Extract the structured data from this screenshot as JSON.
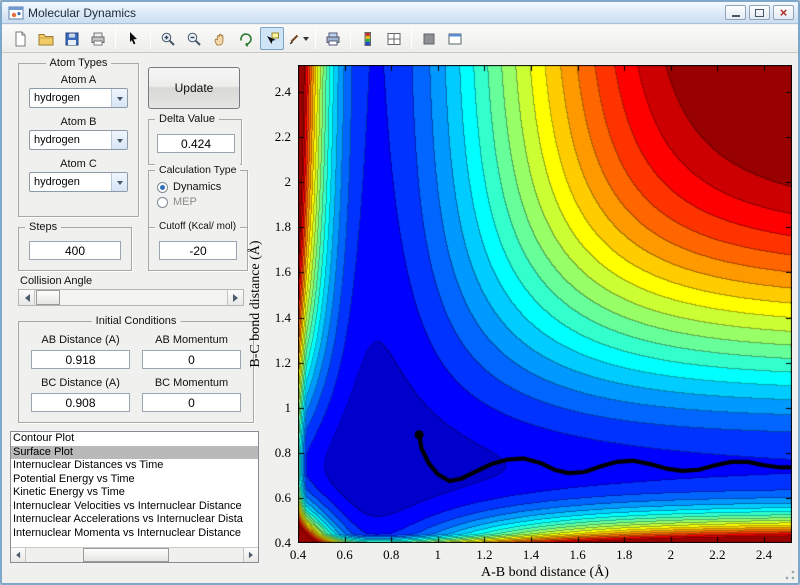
{
  "window": {
    "title": "Molecular Dynamics"
  },
  "titlebar": {
    "buttons": [
      "minimize",
      "maximize",
      "close"
    ]
  },
  "toolbar": {
    "buttons": [
      {
        "name": "new-file"
      },
      {
        "name": "open-file"
      },
      {
        "name": "save"
      },
      {
        "name": "print"
      },
      {
        "separator": true
      },
      {
        "name": "cursor"
      },
      {
        "separator": true
      },
      {
        "name": "zoom-in"
      },
      {
        "name": "zoom-out"
      },
      {
        "name": "pan"
      },
      {
        "name": "rotate-3d"
      },
      {
        "name": "data-cursor",
        "pressed": true
      },
      {
        "name": "brush",
        "dropdown": true
      },
      {
        "separator": true
      },
      {
        "name": "print-figure"
      },
      {
        "separator": true
      },
      {
        "name": "colorbar"
      },
      {
        "name": "subplot"
      },
      {
        "separator": true
      },
      {
        "name": "stop"
      },
      {
        "name": "figure-window"
      }
    ]
  },
  "panels": {
    "atom_types": {
      "title": "Atom Types",
      "fields": [
        {
          "label": "Atom A",
          "value": "hydrogen"
        },
        {
          "label": "Atom B",
          "value": "hydrogen"
        },
        {
          "label": "Atom C",
          "value": "hydrogen"
        }
      ]
    },
    "update_button_label": "Update",
    "delta": {
      "title": "Delta Value",
      "value": "0.424"
    },
    "calculation_type": {
      "title": "Calculation Type",
      "options": [
        {
          "label": "Dynamics",
          "selected": true
        },
        {
          "label": "MEP",
          "selected": false
        }
      ]
    },
    "steps": {
      "title": "Steps",
      "value": "400"
    },
    "cutoff": {
      "title": "Cutoff (Kcal/ mol)",
      "value": "-20"
    },
    "collision_angle": {
      "label": "Collision Angle"
    },
    "initial_conditions": {
      "title": "Initial Conditions",
      "fields": [
        {
          "label": "AB Distance (A)",
          "value": "0.918"
        },
        {
          "label": "AB Momentum",
          "value": "0"
        },
        {
          "label": "BC Distance (A)",
          "value": "0.908"
        },
        {
          "label": "BC Momentum",
          "value": "0"
        }
      ]
    },
    "plot_list": {
      "selected_index": 1,
      "items": [
        "Contour Plot",
        "Surface Plot",
        "Internuclear Distances vs Time",
        "Potential Energy vs Time",
        "Kinetic Energy vs Time",
        "Internuclear Velocities vs Internuclear Distance",
        "Internuclear Accelerations vs Internuclear Dista",
        "Internuclear Momenta vs Internuclear Distance"
      ]
    }
  },
  "chart_data": {
    "type": "contour",
    "title": "",
    "xlabel": "A-B bond distance (Å)",
    "ylabel": "B-C bond distance (Å)",
    "xlim": [
      0.4,
      2.52
    ],
    "ylim": [
      0.4,
      2.52
    ],
    "xticks": {
      "values": [
        0.4,
        0.6,
        0.8,
        1,
        1.2,
        1.4,
        1.6,
        1.8,
        2,
        2.2,
        2.4
      ],
      "labels": [
        "0.4",
        "0.6",
        "0.8",
        "1",
        "1.2",
        "1.4",
        "1.6",
        "1.8",
        "2",
        "2.2",
        "2.4"
      ]
    },
    "yticks": {
      "values": [
        0.4,
        0.6,
        0.8,
        1,
        1.2,
        1.4,
        1.6,
        1.8,
        2,
        2.2,
        2.4
      ],
      "labels": [
        "0.4",
        "0.6",
        "0.8",
        "1",
        "1.2",
        "1.4",
        "1.6",
        "1.8",
        "2",
        "2.2",
        "2.4"
      ]
    },
    "colormap": "jet",
    "grid": false,
    "surface": {
      "model": "sum-of-morse-with-coupling",
      "D": 110,
      "re": 0.74,
      "a_in": 2.3,
      "a_out": 1.9,
      "k": 0.9,
      "lift": 35,
      "lift_center": 1.55,
      "lift_sharpness": 4,
      "vmin": -130,
      "vmax": 10,
      "step": 7
    },
    "trajectory": {
      "color": "#000000",
      "points": [
        [
          0.92,
          0.88
        ],
        [
          0.93,
          0.82
        ],
        [
          0.96,
          0.755
        ],
        [
          1.0,
          0.705
        ],
        [
          1.05,
          0.675
        ],
        [
          1.1,
          0.685
        ],
        [
          1.16,
          0.715
        ],
        [
          1.23,
          0.75
        ],
        [
          1.3,
          0.77
        ],
        [
          1.37,
          0.775
        ],
        [
          1.44,
          0.755
        ],
        [
          1.5,
          0.725
        ],
        [
          1.56,
          0.71
        ],
        [
          1.63,
          0.715
        ],
        [
          1.7,
          0.74
        ],
        [
          1.77,
          0.76
        ],
        [
          1.84,
          0.765
        ],
        [
          1.91,
          0.75
        ],
        [
          1.98,
          0.73
        ],
        [
          2.05,
          0.72
        ],
        [
          2.12,
          0.725
        ],
        [
          2.19,
          0.745
        ],
        [
          2.26,
          0.76
        ],
        [
          2.33,
          0.76
        ],
        [
          2.4,
          0.745
        ],
        [
          2.47,
          0.735
        ],
        [
          2.52,
          0.735
        ]
      ]
    }
  }
}
